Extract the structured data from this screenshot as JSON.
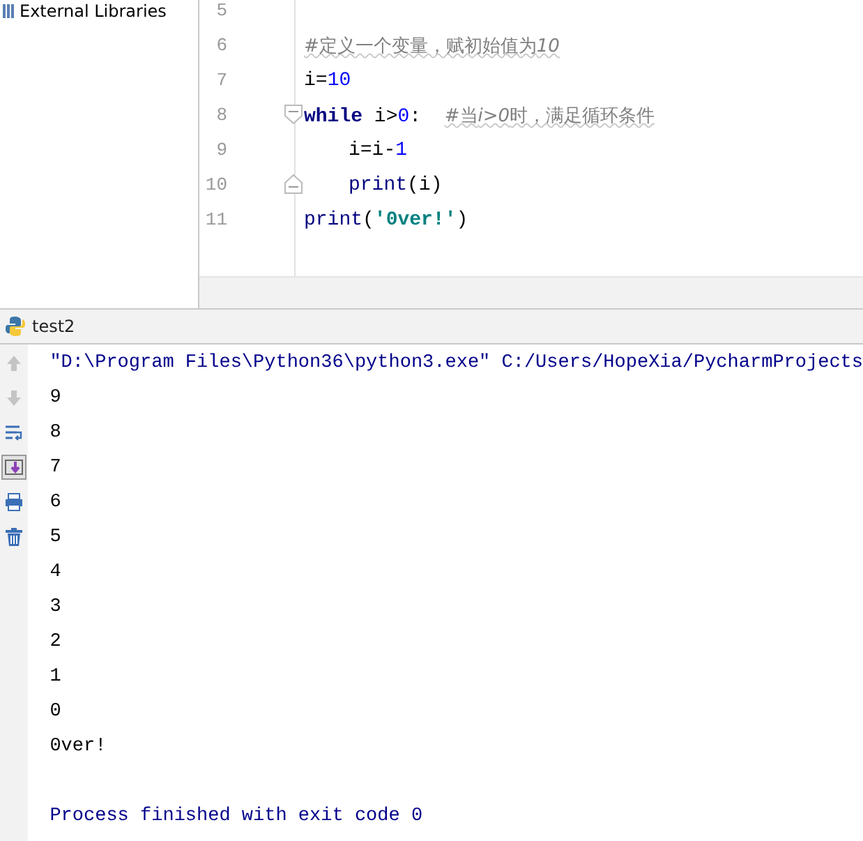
{
  "project_panel": {
    "items": [
      {
        "label": "External Libraries"
      }
    ]
  },
  "editor": {
    "lines": [
      {
        "number": "5",
        "kind": "plain"
      },
      {
        "number": "6",
        "kind": "plain",
        "indented": false,
        "tokens": [
          {
            "kind": "comment",
            "text": "#定义一个变量，赋初始值为"
          },
          {
            "kind": "comment_italic",
            "text": "10"
          }
        ]
      },
      {
        "number": "7",
        "kind": "plain",
        "indented": false,
        "tokens": [
          {
            "kind": "plain",
            "text": "i="
          },
          {
            "kind": "number",
            "text": "10"
          }
        ]
      },
      {
        "number": "8",
        "kind": "fold_start",
        "indented": false,
        "tokens": [
          {
            "kind": "keyword",
            "text": "while"
          },
          {
            "kind": "plain",
            "text": " i>"
          },
          {
            "kind": "number",
            "text": "0"
          },
          {
            "kind": "plain",
            "text": ":  "
          },
          {
            "kind": "comment",
            "text": "#当"
          },
          {
            "kind": "comment_italic",
            "text": "i>0"
          },
          {
            "kind": "comment",
            "text": "时，满足循环条件"
          }
        ]
      },
      {
        "number": "9",
        "kind": "plain",
        "indented": true,
        "tokens": [
          {
            "kind": "plain",
            "text": "i=i-"
          },
          {
            "kind": "number",
            "text": "1"
          }
        ]
      },
      {
        "number": "10",
        "kind": "fold_end",
        "indented": true,
        "tokens": [
          {
            "kind": "builtin",
            "text": "print"
          },
          {
            "kind": "plain",
            "text": "(i)"
          }
        ]
      },
      {
        "number": "11",
        "kind": "plain",
        "indented": false,
        "tokens": [
          {
            "kind": "builtin",
            "text": "print"
          },
          {
            "kind": "plain",
            "text": "("
          },
          {
            "kind": "string",
            "text": "'0ver!'"
          },
          {
            "kind": "plain",
            "text": ")"
          }
        ]
      }
    ]
  },
  "run_panel": {
    "tab": {
      "label": "test2",
      "selected": true
    },
    "tools": [
      {
        "kind": "up",
        "disabled": true
      },
      {
        "kind": "down",
        "disabled": true
      },
      {
        "kind": "wrap",
        "selected": false
      },
      {
        "kind": "scroll",
        "selected": true
      },
      {
        "kind": "print",
        "selected": false
      },
      {
        "kind": "trash",
        "selected": false
      }
    ],
    "console": [
      {
        "kind": "command",
        "text": "\"D:\\Program Files\\Python36\\python3.exe\" C:/Users/HopeXia/PycharmProjects"
      },
      {
        "kind": "output",
        "text": "9"
      },
      {
        "kind": "output",
        "text": "8"
      },
      {
        "kind": "output",
        "text": "7"
      },
      {
        "kind": "output",
        "text": "6"
      },
      {
        "kind": "output",
        "text": "5"
      },
      {
        "kind": "output",
        "text": "4"
      },
      {
        "kind": "output",
        "text": "3"
      },
      {
        "kind": "output",
        "text": "2"
      },
      {
        "kind": "output",
        "text": "1"
      },
      {
        "kind": "output",
        "text": "0"
      },
      {
        "kind": "output",
        "text": "0ver!"
      },
      {
        "kind": "exit",
        "text": "Process finished with exit code 0"
      }
    ]
  }
}
